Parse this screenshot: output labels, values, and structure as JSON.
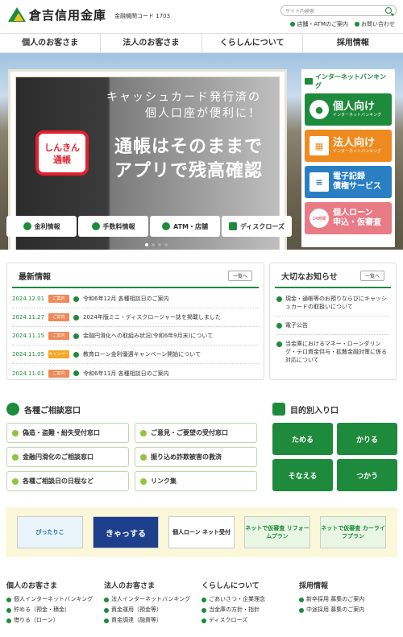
{
  "header": {
    "bank_name": "倉吉信用金庫",
    "code_label": "金融機関コード 1703",
    "search_placeholder": "サイト内検索",
    "links": [
      "店舗・ATMのご案内",
      "お問い合わせ"
    ]
  },
  "nav": [
    "個人のお客さま",
    "法人のお客さま",
    "くらしんについて",
    "採用情報"
  ],
  "hero": {
    "line1": "キャッシュカード発行済の",
    "line2": "個人口座が便利に！",
    "line3": "通帳はそのままで",
    "line4": "アプリで残高確認",
    "app_label_1": "しんきん",
    "app_label_2": "通帳"
  },
  "internet_banking": {
    "title": "インターネットバンキング",
    "personal": {
      "label": "個人向け",
      "sub": "インターネットバンキング"
    },
    "corporate": {
      "label": "法人向け",
      "sub": "インターネットバンキング"
    },
    "densai": {
      "line1": "電子記録",
      "line2": "債権サービス"
    },
    "loan": {
      "line1": "個人ローン",
      "line2": "申込・仮審査",
      "badge": "24時間"
    }
  },
  "quick_links": [
    "金利情報",
    "手数料情報",
    "ATM・店舗",
    "ディスクローズ"
  ],
  "news": {
    "title": "最新情報",
    "more": "一覧へ",
    "items": [
      {
        "date": "2024.12.01",
        "tag": "ご案内",
        "text": "令和6年12月 各種相談日のご案内"
      },
      {
        "date": "2024.11.27",
        "tag": "ご案内",
        "text": "2024年版ミニ・ディスクロージャー誌を掲載しました"
      },
      {
        "date": "2024.11.15",
        "tag": "ご案内",
        "text": "金融円滑化への取組み状況(令和6年9月末)について"
      },
      {
        "date": "2024.11.05",
        "tag": "キャンペーン",
        "text": "教育ローン金利優遇キャンペーン開始について"
      },
      {
        "date": "2024.11.01",
        "tag": "ご案内",
        "text": "令和6年11月 各種相談日のご案内"
      }
    ]
  },
  "important": {
    "title": "大切なお知らせ",
    "more": "一覧へ",
    "items": [
      "現金・通帳等のお預りならびにキャッシュカードの取扱いについて",
      "電子公告",
      "当金庫におけるマネー・ローンダリング・テロ資金供与・拡散金融対策に係る対応について"
    ]
  },
  "consult": {
    "title": "各種ご相談窓口",
    "items": [
      "偽造・盗難・紛失受付窓口",
      "ご意見・ご要望の受付窓口",
      "金融円滑化のご相談窓口",
      "振り込め詐欺被害の救済",
      "各種ご相談日の日程など",
      "リンク集"
    ]
  },
  "purpose": {
    "title": "目的別入り口",
    "items": [
      "ためる",
      "かりる",
      "そなえる",
      "つかう"
    ]
  },
  "ads": [
    "ぴったりこ",
    "きゃっする",
    "個人ローン ネット受付",
    "ネットで仮審査 リフォームプラン",
    "ネットで仮審査 カーライフプラン"
  ],
  "footer": [
    {
      "title": "個人のお客さま",
      "links": [
        "個人インターネットバンキング",
        "貯める（預金・積金）",
        "借りる（ローン）"
      ]
    },
    {
      "title": "法人のお客さま",
      "links": [
        "法人インターネットバンキング",
        "資金運用（預金等）",
        "資金調達（融資等）"
      ]
    },
    {
      "title": "くらしんについて",
      "links": [
        "ごあいさつ・企業理念",
        "当金庫の方針・指針",
        "ディスクローズ"
      ]
    },
    {
      "title": "採用情報",
      "links": [
        "新卒採用 募集のご案内",
        "中途採用 募集のご案内"
      ]
    }
  ]
}
